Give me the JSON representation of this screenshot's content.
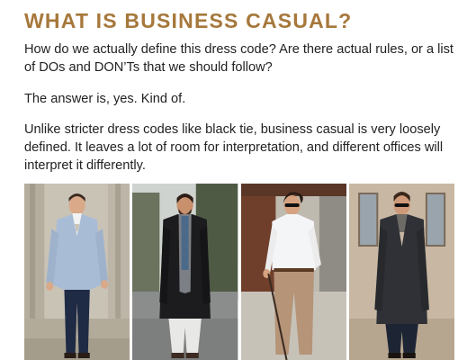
{
  "article": {
    "heading": "WHAT IS BUSINESS CASUAL?",
    "paragraphs": [
      "How do we actually define this dress code? Are there actual rules, or a list of DOs and DON’Ts that we should follow?",
      "The answer is, yes. Kind of.",
      "Unlike stricter dress codes like black tie, business casual is very loosely defined. It leaves a lot of room for interpretation, and different offices will interpret it differently."
    ]
  },
  "photos": [
    {
      "subject": "man-light-blue-blazer-navy-trousers"
    },
    {
      "subject": "man-black-overcoat-grey-scarf-white-jeans"
    },
    {
      "subject": "man-white-shirt-tan-trousers-sunglasses"
    },
    {
      "subject": "man-charcoal-overcoat-sunglasses"
    }
  ],
  "colors": {
    "heading": "#a6783c",
    "body_text": "#222222",
    "background": "#ffffff"
  }
}
